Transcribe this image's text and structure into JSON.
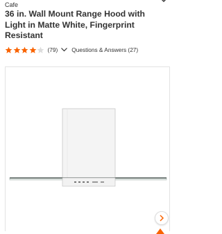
{
  "product": {
    "brand": "Cafe",
    "title": "36 in. Wall Mount Range Hood with Light in Matte White, Fingerprint Resistant"
  },
  "rating": {
    "stars": 4,
    "max_stars": 5,
    "review_count": "(79)",
    "qa_label": "Questions & Answers (27)"
  },
  "icons": {
    "top": "chevron-down-icon",
    "star": "star-icon",
    "qa": "chevron-down-icon",
    "next": "chevron-right-icon",
    "badge": "orange-badge-icon"
  },
  "colors": {
    "star": "#f96302",
    "accent": "#f96302",
    "text": "#333333",
    "chevron": "#f96302"
  }
}
